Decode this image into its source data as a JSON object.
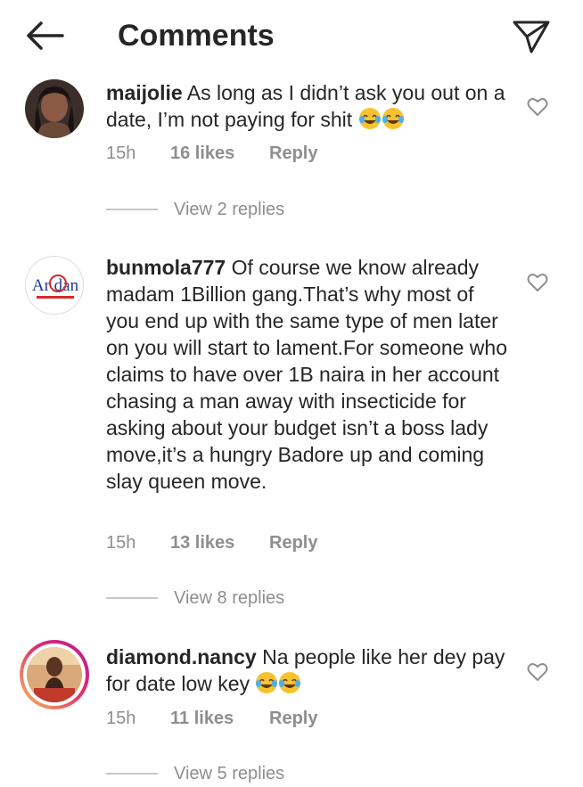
{
  "header": {
    "title": "Comments"
  },
  "comments": [
    {
      "username": "maijolie",
      "text": "As long as I didn’t ask you out on a date, I’m not paying for shit",
      "time": "15h",
      "likes": "16 likes",
      "reply": "Reply",
      "view_replies": "View 2 replies"
    },
    {
      "username": "bunmola777",
      "text": "Of course we know already madam 1Billion gang.That’s why most of you end up with the same type of men later on you will start to lament.For someone who claims to have over 1B naira in her account chasing a man away with insecticide for asking about your budget isn’t a boss lady move,it’s a hungry Badore up and coming slay queen move.",
      "time": "15h",
      "likes": "13 likes",
      "reply": "Reply",
      "view_replies": "View 8 replies",
      "avatar_logo": "Ar dan"
    },
    {
      "username": "diamond.nancy",
      "text": "Na people like her dey pay for date low key",
      "time": "15h",
      "likes": "11 likes",
      "reply": "Reply",
      "view_replies": "View 5 replies"
    }
  ],
  "icons": {
    "back": "arrow-left-icon",
    "share": "send-icon",
    "like": "heart-outline-icon",
    "emoji": "face-with-tears-of-joy-emoji"
  },
  "colors": {
    "text": "#262626",
    "secondary": "#8e8e8e",
    "divider": "#c7c7c7",
    "story_ring_start": "#f9c15b",
    "story_ring_end": "#b5179e"
  }
}
